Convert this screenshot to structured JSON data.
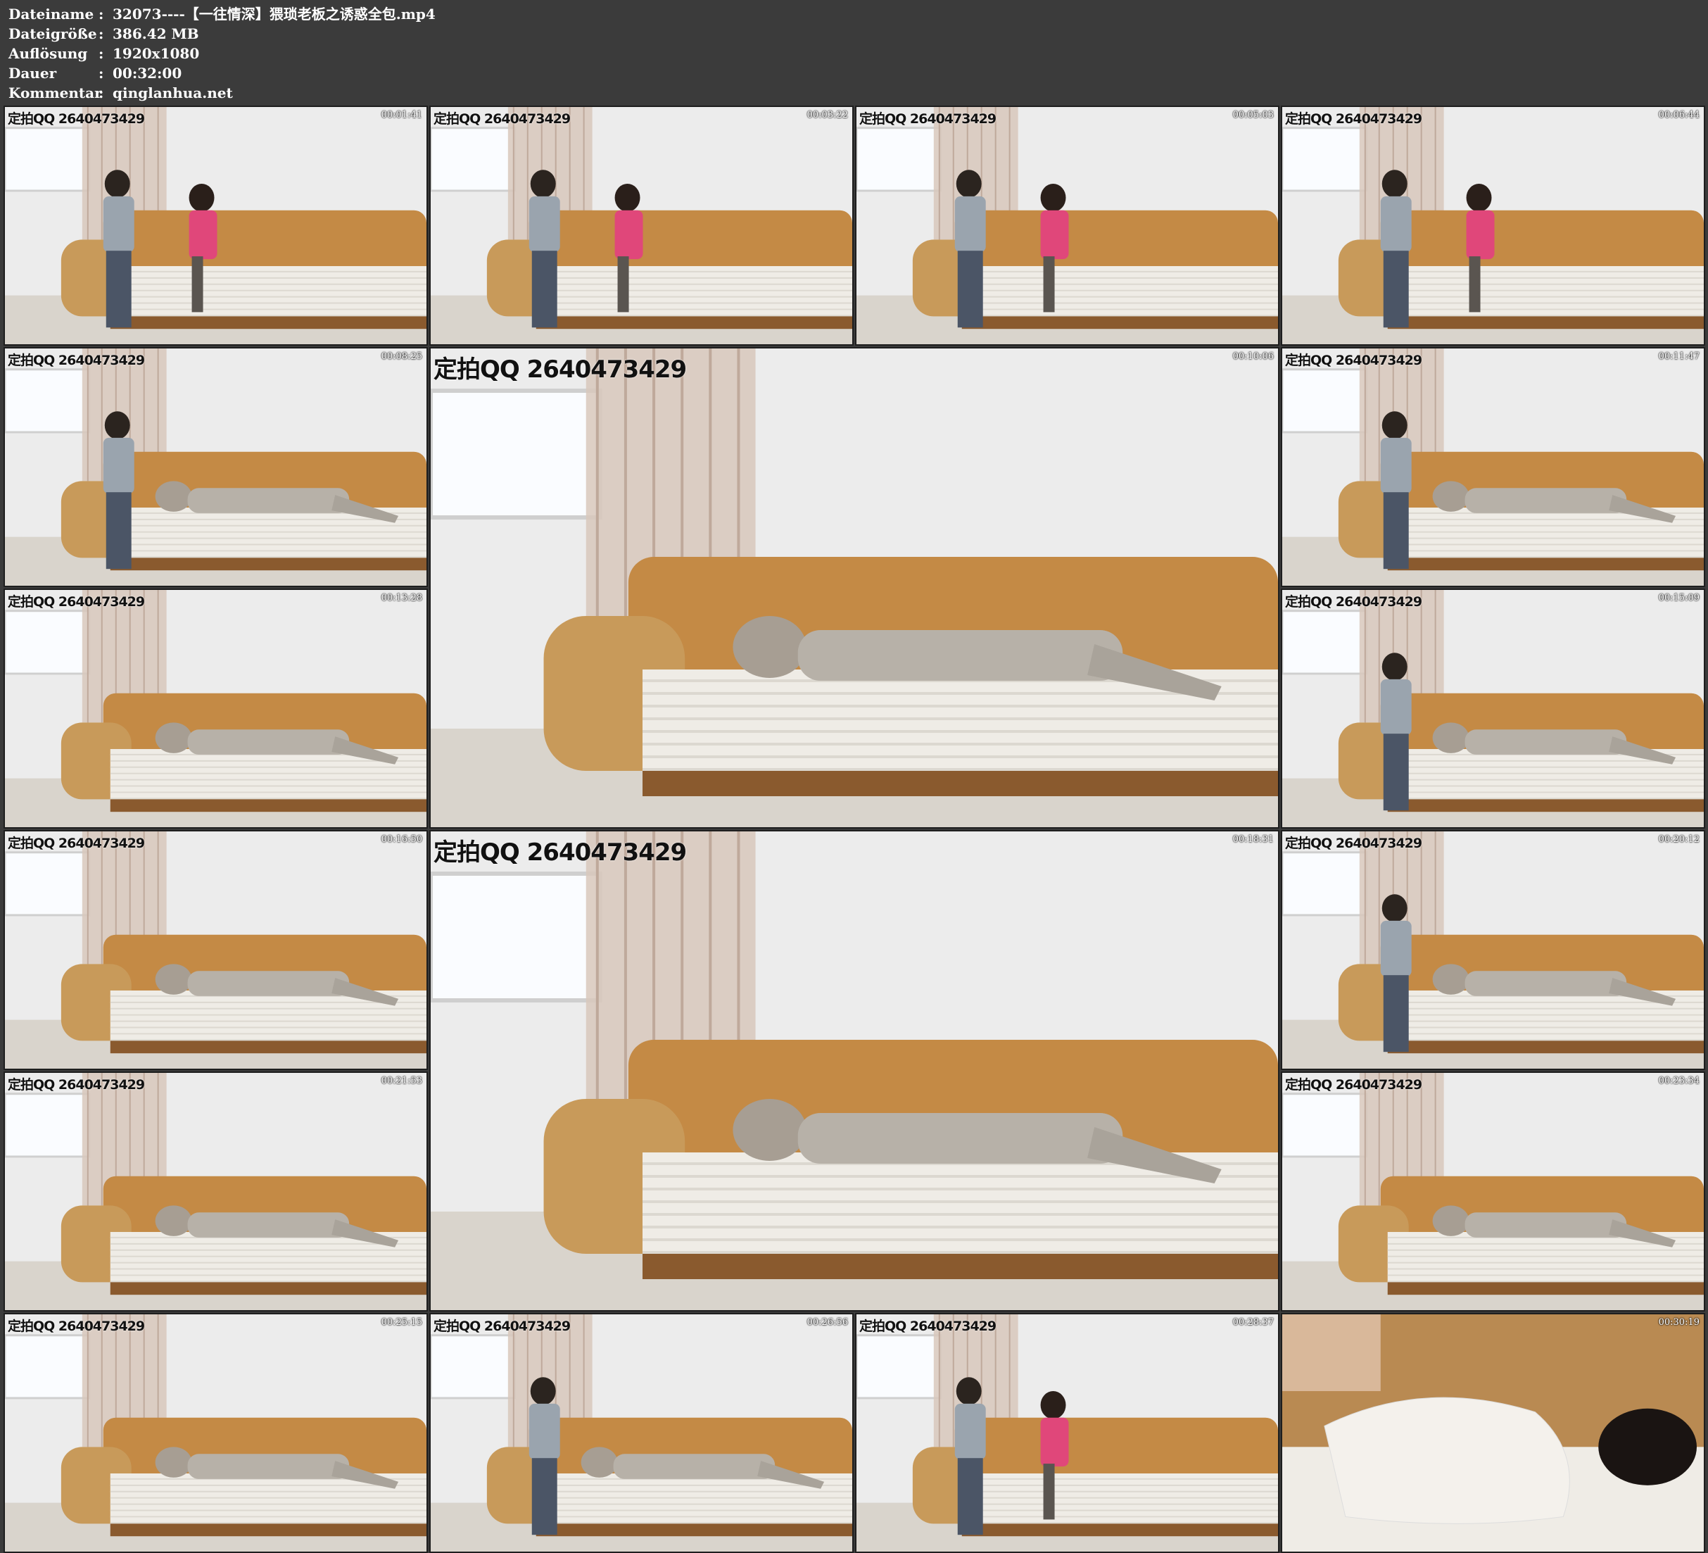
{
  "header": {
    "rows": [
      {
        "key": "Dateiname",
        "value": "32073----【一往情深】猥琐老板之诱惑全包.mp4"
      },
      {
        "key": "Dateigröße",
        "value": "386.42 MB"
      },
      {
        "key": "Auflösung",
        "value": "1920x1080"
      },
      {
        "key": "Dauer",
        "value": "00:32:00"
      },
      {
        "key": "Kommentar",
        "value": "qinglanhua.net"
      }
    ],
    "separator": ":"
  },
  "thumbnails": [
    {
      "timestamp": "00:01:41",
      "watermark": "定拍QQ 2640473429",
      "scene": "sofa-sitting-woman"
    },
    {
      "timestamp": "00:03:22",
      "watermark": "定拍QQ 2640473429",
      "scene": "sofa-couple"
    },
    {
      "timestamp": "00:05:03",
      "watermark": "定拍QQ 2640473429",
      "scene": "sofa-sitting-woman"
    },
    {
      "timestamp": "00:06:44",
      "watermark": "定拍QQ 2640473429",
      "scene": "sofa-couple"
    },
    {
      "timestamp": "00:08:25",
      "watermark": "定拍QQ 2640473429",
      "scene": "sofa-lying-man-standing"
    },
    {
      "timestamp": "00:10:06",
      "watermark": "定拍QQ 2640473429",
      "scene": "sofa-lying"
    },
    {
      "timestamp": "00:11:47",
      "watermark": "定拍QQ 2640473429",
      "scene": "sofa-lying-man-standing"
    },
    {
      "timestamp": "00:13:28",
      "watermark": "定拍QQ 2640473429",
      "scene": "sofa-lying"
    },
    {
      "timestamp": "00:15:09",
      "watermark": "定拍QQ 2640473429",
      "scene": "sofa-lying-man-kneeling"
    },
    {
      "timestamp": "00:16:50",
      "watermark": "定拍QQ 2640473429",
      "scene": "sofa-lying"
    },
    {
      "timestamp": "00:18:31",
      "watermark": "定拍QQ 2640473429",
      "scene": "sofa-lying"
    },
    {
      "timestamp": "00:20:12",
      "watermark": "定拍QQ 2640473429",
      "scene": "sofa-lying-man-standing"
    },
    {
      "timestamp": "00:21:53",
      "watermark": "定拍QQ 2640473429",
      "scene": "sofa-lying"
    },
    {
      "timestamp": "00:23:34",
      "watermark": "定拍QQ 2640473429",
      "scene": "sofa-lying"
    },
    {
      "timestamp": "00:25:15",
      "watermark": "定拍QQ 2640473429",
      "scene": "sofa-lying"
    },
    {
      "timestamp": "00:26:56",
      "watermark": "定拍QQ 2640473429",
      "scene": "sofa-lying-man-standing"
    },
    {
      "timestamp": "00:28:37",
      "watermark": "定拍QQ 2640473429",
      "scene": "sofa-sitting-woman"
    },
    {
      "timestamp": "00:30:19",
      "watermark": "",
      "scene": "floor-closeup"
    }
  ],
  "colors": {
    "background": "#3b3b3b",
    "header_text": "#ffffff",
    "wall": "#ececec",
    "curtain": "#d8c8bc",
    "sofa_back": "#c48a45",
    "sofa_seat": "#efece6",
    "floor": "#d9d4cc"
  }
}
